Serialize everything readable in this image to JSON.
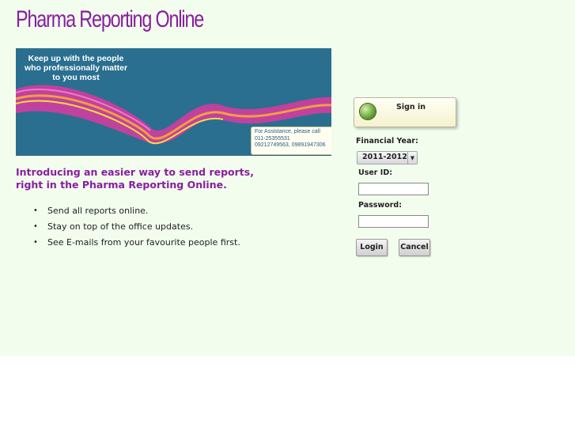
{
  "header": {
    "logo_text": "Pharma Reporting Online"
  },
  "banner": {
    "tagline": "Keep up with the people who professionally matter to you most",
    "assistance": {
      "line1": "For Assistance, please call",
      "line2": "011-25355531",
      "line3": "09212749563, 09891947306"
    }
  },
  "intro": {
    "heading": "Introducing an easier way to send reports, right in the Pharma Reporting Online.",
    "bullets": [
      "Send all reports online.",
      "Stay on top of the office updates.",
      "See E-mails from your favourite people first."
    ]
  },
  "login": {
    "signin_label": "Sign in",
    "financial_year_label": "Financial Year:",
    "financial_year_value": "2011-2012",
    "userid_label": "User ID:",
    "userid_value": "",
    "password_label": "Password:",
    "password_value": "",
    "login_button": "Login",
    "cancel_button": "Cancel"
  },
  "colors": {
    "page_background": "#f2fdee",
    "brand_purple": "#8a1ea0",
    "banner_teal": "#2a6f8f"
  }
}
